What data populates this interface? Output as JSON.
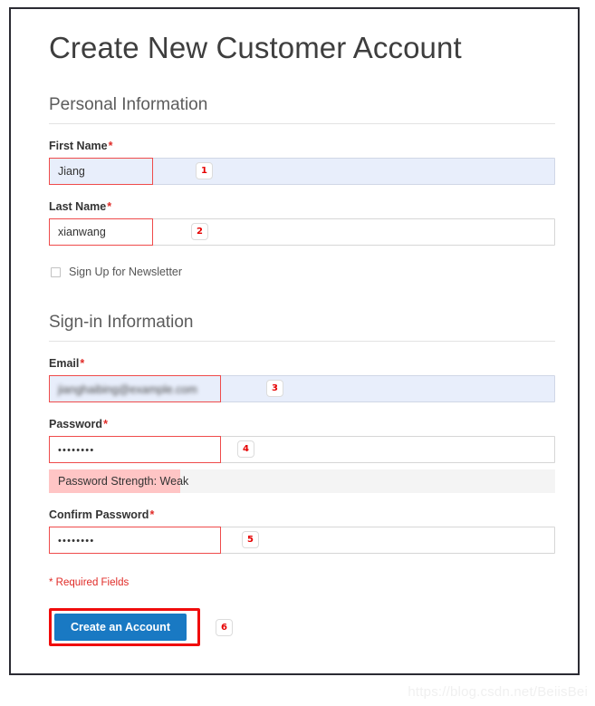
{
  "page": {
    "title": "Create New Customer Account",
    "watermark": "https://blog.csdn.net/BeiisBei",
    "required_note": "* Required Fields",
    "required_marker": "*"
  },
  "colors": {
    "accent_blue": "#1979c3",
    "annotation_red": "#ef4b4b",
    "button_anno_red": "#f00c0c",
    "required_red": "#e02b27",
    "focus_fill": "#e8eefb",
    "strength_fill": "#ffc5c5",
    "strength_track": "#f4f4f4",
    "frame": "#2b2b33"
  },
  "personal_information": {
    "legend": "Personal Information",
    "fields": [
      {
        "label": "First Name",
        "required": true,
        "value": "Jiang",
        "placeholder": "",
        "focused": true,
        "annotation": "1"
      },
      {
        "label": "Last Name",
        "required": true,
        "value": "xianwang",
        "placeholder": "",
        "focused": false,
        "annotation": "2"
      }
    ],
    "newsletter": {
      "label": "Sign Up for Newsletter",
      "checked": false
    }
  },
  "signin_information": {
    "legend": "Sign-in Information",
    "fields": [
      {
        "label": "Email",
        "required": true,
        "value": "jianghaibing@example.com",
        "placeholder": "",
        "focused": true,
        "redacted": true,
        "annotation": "3"
      },
      {
        "label": "Password",
        "required": true,
        "value": "••••••••",
        "placeholder": "",
        "focused": false,
        "annotation": "4"
      },
      {
        "label": "Confirm Password",
        "required": true,
        "value": "••••••••",
        "placeholder": "",
        "focused": false,
        "annotation": "5"
      }
    ],
    "password_strength": {
      "text": "Password Strength: Weak",
      "level": "Weak",
      "fill_percent": 26
    }
  },
  "submit": {
    "label": "Create an Account",
    "annotation": "6"
  }
}
